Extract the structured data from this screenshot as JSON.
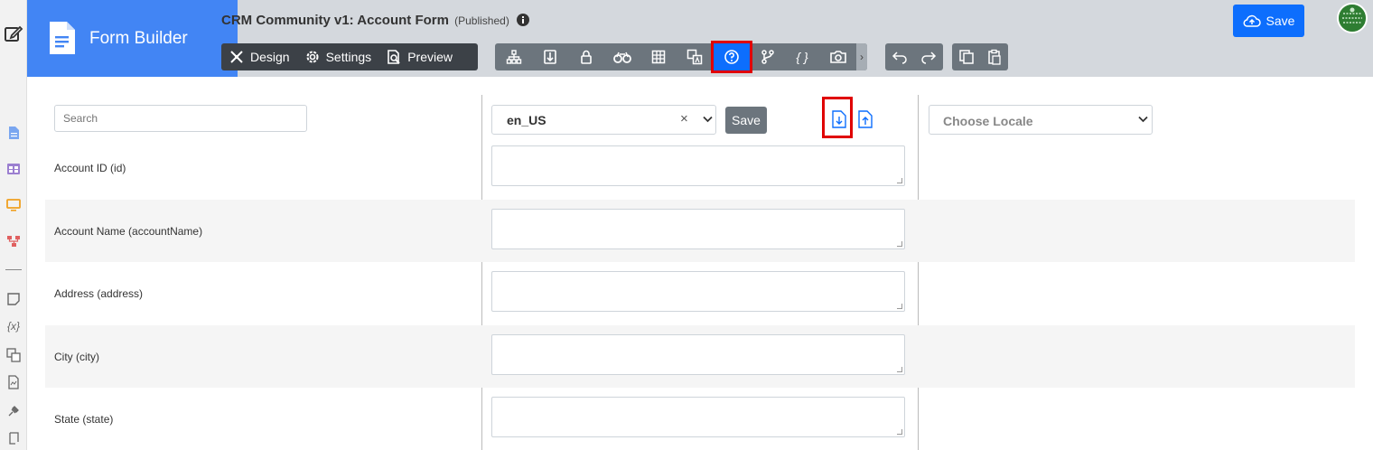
{
  "app": {
    "title": "Form Builder"
  },
  "form": {
    "title": "CRM Community v1: Account Form",
    "status": "(Published)"
  },
  "modes": {
    "design": "Design",
    "settings": "Settings",
    "preview": "Preview"
  },
  "toolbar": {
    "icons": [
      "sitemap-icon",
      "import-export-icon",
      "lock-icon",
      "binoculars-icon",
      "grid-icon",
      "translate-icon",
      "help-icon",
      "branch-icon",
      "braces-icon",
      "camera-icon"
    ],
    "active": "help-icon",
    "braces_glyph": "{ }",
    "more_glyph": "›"
  },
  "actions": {
    "save_label": "Save"
  },
  "search": {
    "placeholder": "Search"
  },
  "locale": {
    "value": "en_US",
    "clear_glyph": "×",
    "save_label": "Save",
    "choose_placeholder": "Choose Locale"
  },
  "sidebar_icons": [
    "edit-icon",
    "form-icon",
    "table-icon",
    "monitor-icon",
    "flow-icon",
    "note-icon",
    "variable-icon",
    "translate-icon",
    "document-icon",
    "plugin-icon",
    "script-icon"
  ],
  "sidebar": {
    "variable_glyph": "{x}"
  },
  "fields": [
    {
      "label": "Account ID (id)",
      "value": ""
    },
    {
      "label": "Account Name (accountName)",
      "value": ""
    },
    {
      "label": "Address (address)",
      "value": ""
    },
    {
      "label": "City (city)",
      "value": ""
    },
    {
      "label": "State (state)",
      "value": ""
    }
  ],
  "colors": {
    "brand": "#4285f4",
    "primary": "#0d6efd",
    "highlight": "#e00000",
    "header_bg": "#d4d8dd"
  }
}
